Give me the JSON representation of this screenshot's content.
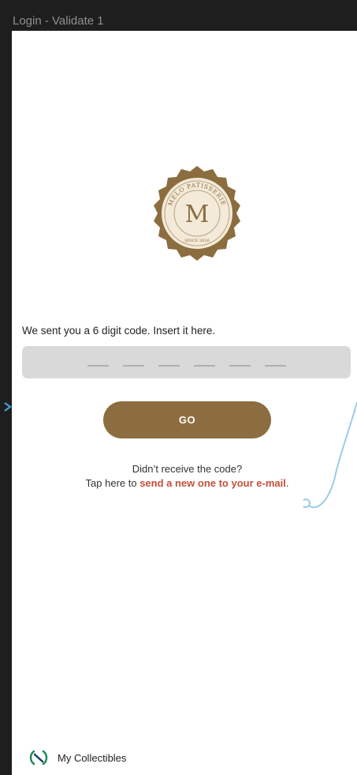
{
  "frame": {
    "title": "Login - Validate 1"
  },
  "logo": {
    "brand_text": "MELO PATISSERIE",
    "monogram": "M",
    "since_text": "SINCE 2016",
    "colors": {
      "seal": "#8b6d3f",
      "inner": "#f3ead9",
      "line": "#b9a27a"
    }
  },
  "verification": {
    "instruction": "We sent you a 6 digit code. Insert it here.",
    "code_slots": 6,
    "submit_label": "GO"
  },
  "resend": {
    "question": "Didn’t receive the code?",
    "prefix": "Tap here to ",
    "link_text": "send a new one to your e-mail",
    "suffix": "."
  },
  "footer": {
    "label": "My Collectibles",
    "icon": "collectibles-icon"
  },
  "colors": {
    "accent": "#8b6d3f",
    "link": "#c0503b",
    "input_bg": "#d9d9d9",
    "prototype_line": "#9ccbe8"
  }
}
